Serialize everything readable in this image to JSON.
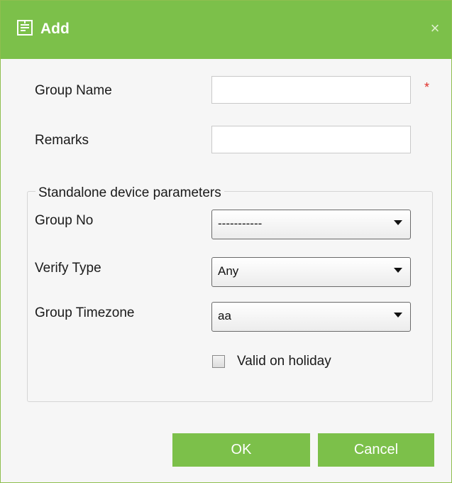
{
  "dialog": {
    "title": "Add",
    "close_symbol": "×",
    "title_icon": "form-icon",
    "accent_color": "#7cc04a"
  },
  "form": {
    "group_name_label": "Group Name",
    "group_name_value": "",
    "required_mark": "*",
    "remarks_label": "Remarks",
    "remarks_value": ""
  },
  "standalone": {
    "legend": "Standalone device parameters",
    "group_no_label": "Group No",
    "group_no_value": "-----------",
    "verify_type_label": "Verify Type",
    "verify_type_value": "Any",
    "group_timezone_label": "Group Timezone",
    "group_timezone_value": "aa",
    "valid_on_holiday_label": "Valid on holiday",
    "valid_on_holiday_checked": false
  },
  "buttons": {
    "ok_label": "OK",
    "cancel_label": "Cancel"
  }
}
